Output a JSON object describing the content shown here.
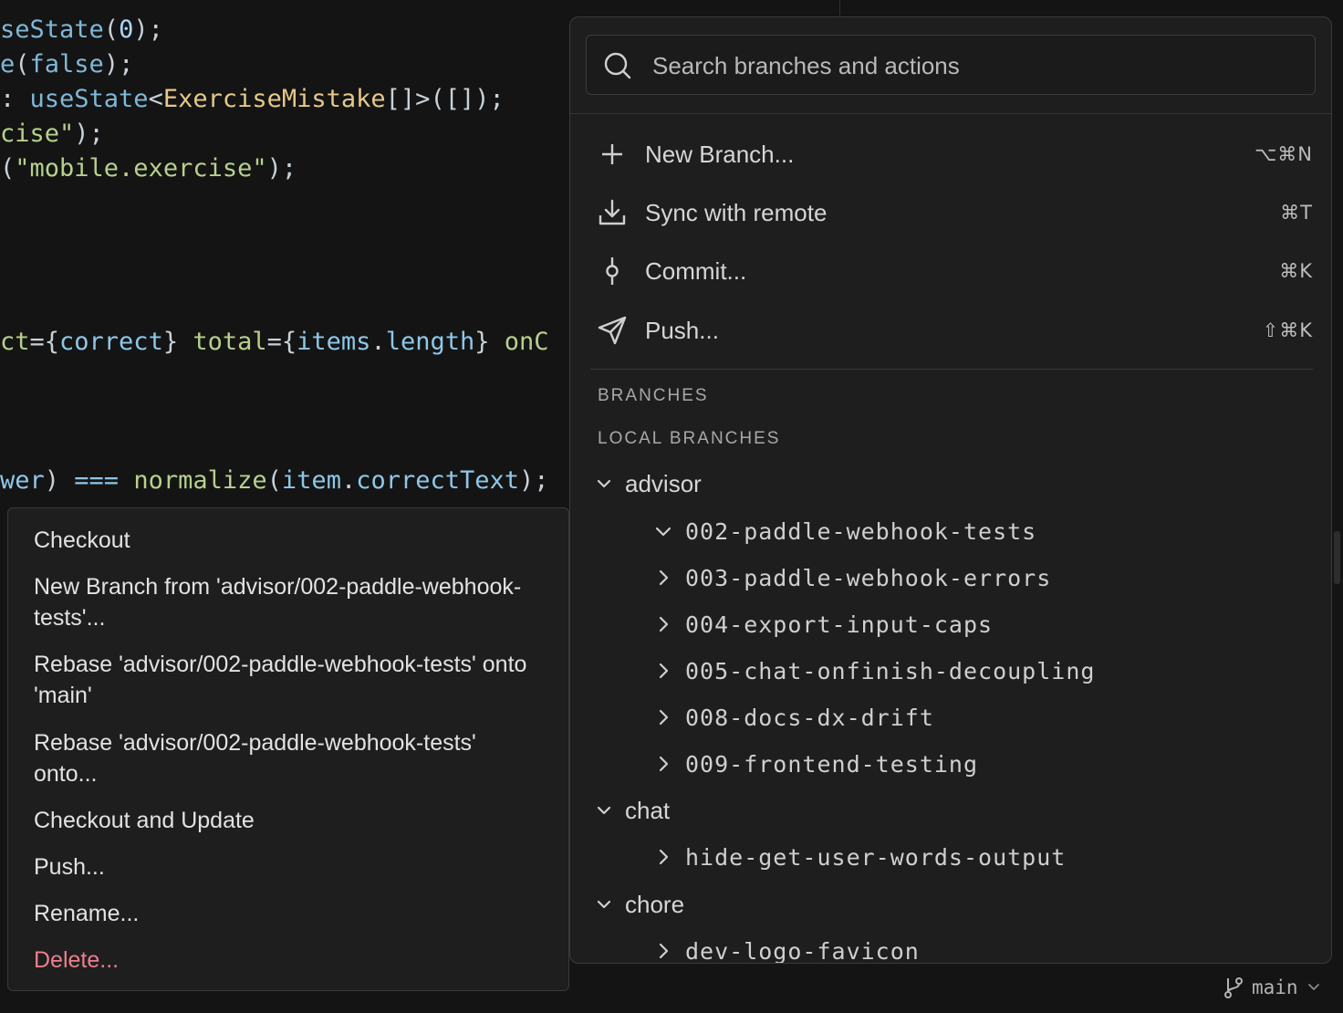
{
  "editor": {
    "lines": [
      {
        "parts": [
          {
            "t": "seState",
            "c": "c-fn"
          },
          {
            "t": "(",
            "c": "c-pun"
          },
          {
            "t": "0",
            "c": "c-num"
          },
          {
            "t": ");",
            "c": "c-pun"
          }
        ]
      },
      {
        "parts": [
          {
            "t": "e",
            "c": "c-fn"
          },
          {
            "t": "(",
            "c": "c-pun"
          },
          {
            "t": "false",
            "c": "c-kw"
          },
          {
            "t": ");",
            "c": "c-pun"
          }
        ]
      },
      {
        "parts": [
          {
            "t": ": ",
            "c": "c-pun"
          },
          {
            "t": "useState",
            "c": "c-fn"
          },
          {
            "t": "<",
            "c": "c-pun"
          },
          {
            "t": "ExerciseMistake",
            "c": "c-type"
          },
          {
            "t": "[]>([]);",
            "c": "c-pun"
          }
        ]
      },
      {
        "parts": [
          {
            "t": "cise\"",
            "c": "c-str"
          },
          {
            "t": ");",
            "c": "c-pun"
          }
        ]
      },
      {
        "parts": [
          {
            "t": "(",
            "c": "c-pun"
          },
          {
            "t": "\"mobile.exercise\"",
            "c": "c-str"
          },
          {
            "t": ");",
            "c": "c-pun"
          }
        ]
      },
      {
        "parts": [
          {
            "t": "ct",
            "c": "c-attr"
          },
          {
            "t": "={",
            "c": "c-pun"
          },
          {
            "t": "correct",
            "c": "c-prop"
          },
          {
            "t": "} ",
            "c": "c-pun"
          },
          {
            "t": "total",
            "c": "c-attr"
          },
          {
            "t": "={",
            "c": "c-pun"
          },
          {
            "t": "items",
            "c": "c-prop"
          },
          {
            "t": ".",
            "c": "c-pun"
          },
          {
            "t": "length",
            "c": "c-prop"
          },
          {
            "t": "} ",
            "c": "c-pun"
          },
          {
            "t": "onC",
            "c": "c-attr"
          }
        ]
      },
      {
        "parts": [
          {
            "t": "wer",
            "c": "c-prop"
          },
          {
            "t": ") ",
            "c": "c-pun"
          },
          {
            "t": "===",
            "c": "c-op"
          },
          {
            "t": " ",
            "c": "c-pun"
          },
          {
            "t": "normalize",
            "c": "c-attr"
          },
          {
            "t": "(",
            "c": "c-pun"
          },
          {
            "t": "item",
            "c": "c-prop"
          },
          {
            "t": ".",
            "c": "c-pun"
          },
          {
            "t": "correctText",
            "c": "c-prop"
          },
          {
            "t": ");",
            "c": "c-pun"
          }
        ]
      }
    ]
  },
  "picker": {
    "search_placeholder": "Search branches and actions",
    "actions": [
      {
        "label": "New Branch...",
        "shortcut": "⌥⌘N",
        "icon": "plus-icon"
      },
      {
        "label": "Sync with remote",
        "shortcut": "⌘T",
        "icon": "download-icon"
      },
      {
        "label": "Commit...",
        "shortcut": "⌘K",
        "icon": "commit-icon"
      },
      {
        "label": "Push...",
        "shortcut": "⇧⌘K",
        "icon": "send-icon"
      }
    ],
    "sections": {
      "branches": "BRANCHES",
      "local_branches": "LOCAL BRANCHES"
    },
    "groups": {
      "advisor": "advisor",
      "chat": "chat",
      "chore": "chore"
    },
    "advisor_branches": [
      "002-paddle-webhook-tests",
      "003-paddle-webhook-errors",
      "004-export-input-caps",
      "005-chat-onfinish-decoupling",
      "008-docs-dx-drift",
      "009-frontend-testing"
    ],
    "chat_branches": [
      "hide-get-user-words-output"
    ],
    "chore_branches": [
      "dev-logo-favicon"
    ]
  },
  "context_menu": {
    "items": [
      "Checkout",
      "New Branch from 'advisor/002-paddle-webhook-tests'...",
      "Rebase 'advisor/002-paddle-webhook-tests' onto 'main'",
      "Rebase 'advisor/002-paddle-webhook-tests' onto...",
      "Checkout and Update",
      "Push...",
      "Rename...",
      "Delete..."
    ],
    "danger_color": "#ec7f8d"
  },
  "status_bar": {
    "branch": "main"
  }
}
